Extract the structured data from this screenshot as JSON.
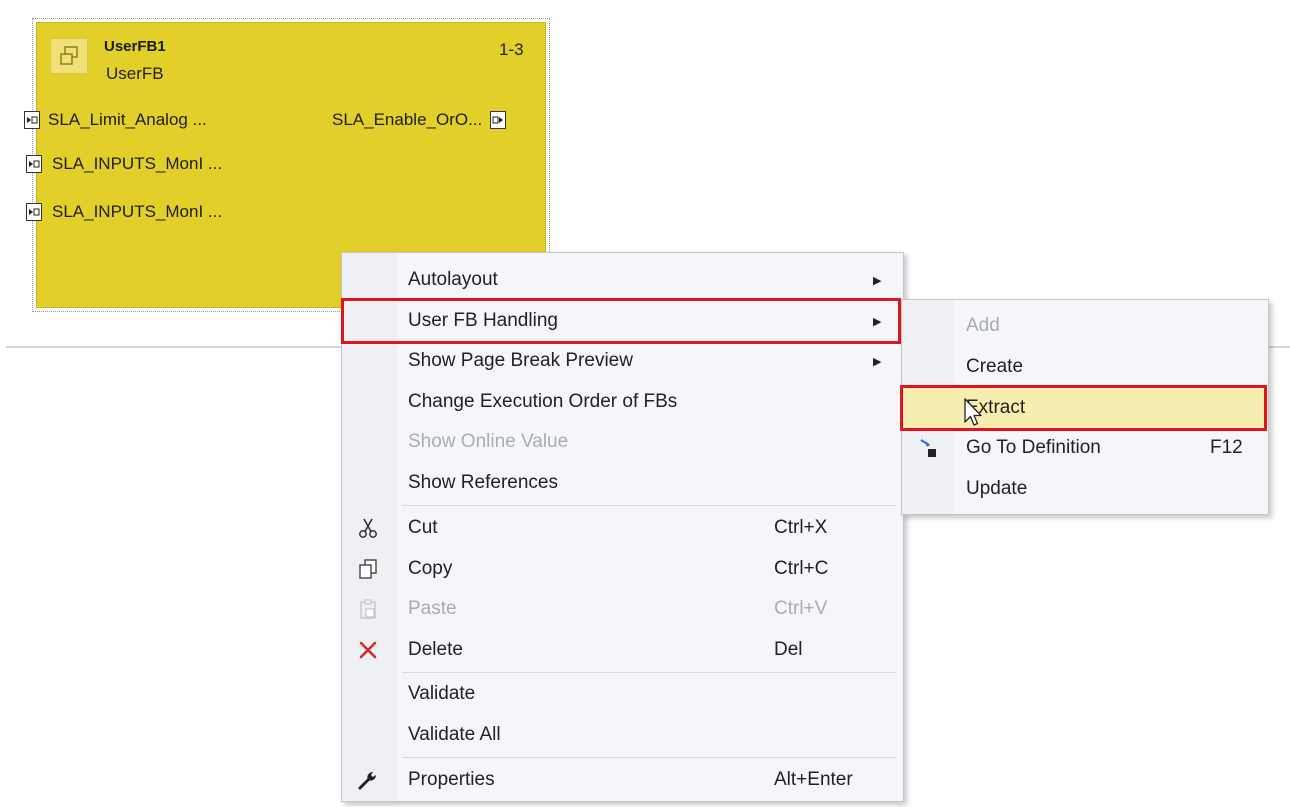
{
  "function_block": {
    "instance_name": "UserFB1",
    "type_name": "UserFB",
    "execution_order": "1-3",
    "inputs": [
      "SLA_Limit_Analog ...",
      "SLA_INPUTS_MonI ...",
      "SLA_INPUTS_MonI ..."
    ],
    "outputs": [
      "SLA_Enable_OrO..."
    ]
  },
  "context_menu": {
    "items": [
      {
        "label": "Autolayout",
        "has_submenu": true,
        "enabled": true
      },
      {
        "label": "User FB Handling",
        "has_submenu": true,
        "enabled": true,
        "highlighted": true
      },
      {
        "label": "Show Page Break Preview",
        "has_submenu": true,
        "enabled": true
      },
      {
        "label": "Change Execution Order of FBs",
        "enabled": true
      },
      {
        "label": "Show Online Value",
        "enabled": false
      },
      {
        "label": "Show References",
        "enabled": true
      },
      {
        "label": "Cut",
        "shortcut": "Ctrl+X",
        "icon": "scissors-icon",
        "enabled": true
      },
      {
        "label": "Copy",
        "shortcut": "Ctrl+C",
        "icon": "copy-icon",
        "enabled": true
      },
      {
        "label": "Paste",
        "shortcut": "Ctrl+V",
        "icon": "paste-icon",
        "enabled": false
      },
      {
        "label": "Delete",
        "shortcut": "Del",
        "icon": "delete-x-icon",
        "enabled": true
      },
      {
        "label": "Validate",
        "enabled": true
      },
      {
        "label": "Validate All",
        "enabled": true
      },
      {
        "label": "Properties",
        "shortcut": "Alt+Enter",
        "icon": "wrench-icon",
        "enabled": true
      }
    ]
  },
  "submenu": {
    "parent": "User FB Handling",
    "items": [
      {
        "label": "Add",
        "enabled": false
      },
      {
        "label": "Create",
        "enabled": true
      },
      {
        "label": "Extract",
        "enabled": true,
        "hovered": true,
        "highlighted": true
      },
      {
        "label": "Go To Definition",
        "shortcut": "F12",
        "icon": "go-to-definition-icon",
        "enabled": true
      },
      {
        "label": "Update",
        "enabled": true
      }
    ]
  },
  "colors": {
    "fb_fill": "#e2cf2a",
    "menu_bg": "#f5f6f9",
    "hover_fill": "#f8edb0",
    "highlight_border": "#e0141f",
    "delete_icon": "#d32b2b"
  }
}
